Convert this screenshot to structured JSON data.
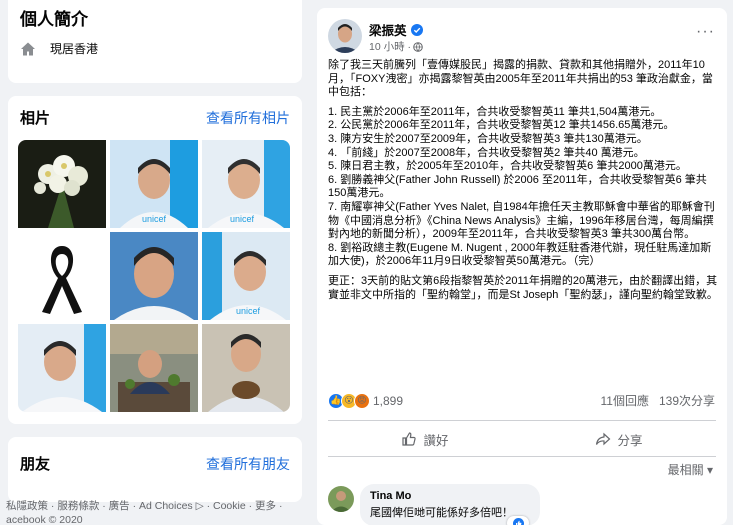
{
  "intro": {
    "title": "個人簡介",
    "location_icon": "home-icon",
    "location": "現居香港"
  },
  "photos_section": {
    "title": "相片",
    "see_all": "查看所有相片",
    "photos": [
      {
        "desc": "white flowers bouquet",
        "icon": "photo"
      },
      {
        "desc": "man in unicef shirt",
        "icon": "photo"
      },
      {
        "desc": "man in unicef shirt smiling",
        "icon": "photo"
      },
      {
        "desc": "black mourning ribbon",
        "icon": "photo"
      },
      {
        "desc": "man close-up portrait",
        "icon": "photo"
      },
      {
        "desc": "man in unicef shirt",
        "icon": "photo"
      },
      {
        "desc": "man in unicef shirt",
        "icon": "photo"
      },
      {
        "desc": "man kneeling at planter",
        "icon": "photo"
      },
      {
        "desc": "man holding food item",
        "icon": "photo"
      }
    ]
  },
  "friends_section": {
    "title": "朋友",
    "see_all": "查看所有朋友"
  },
  "footer": {
    "line1": "私隱政策 · 服務條款 · 廣告 · Ad Choices ▷ · Cookie · 更多 ·",
    "line2": "acebook © 2020"
  },
  "post": {
    "author": "梁振英",
    "time": "10 小時 ·",
    "more": "···",
    "paragraphs": [
      "除了我三天前騰列「壹傳媒股民」揭露的捐款、貸款和其他捐贈外，2011年10月，「FOXY洩密」亦揭露黎智英由2005年至2011年共捐出的53 筆政治獻金，當中包括：",
      "1. 民主黨於2006年至2011年，合共收受黎智英11 筆共1,504萬港元。\n2. 公民黨於2006年至2011年，合共收受黎智英12 筆共1456.65萬港元。\n3. 陳方安生於2007至2009年，合共收受黎智英3 筆共130萬港元。\n4. 「前綫」於2007至2008年，合共收受黎智英2 筆共40 萬港元。\n5. 陳日君主教，於2005年至2010年，合共收受黎智英6 筆共2000萬港元。\n6. 劉勝義神父(Father John Russell) 於2006 至2011年，合共收受黎智英6 筆共150萬港元。\n7. 南耀寧神父(Father Yves Nalet, 自1984年擔任天主教耶穌會中華省的耶穌會刊物《中國消息分析》《China News Analysis》主編，1996年移居台灣，每周編撰對內地的新聞分析），2009年至2011年，合共收受黎智英3 筆共300萬台幣。\n8. 劉裕政總主教(Eugene M. Nugent , 2000年教廷駐香港代辦，現任駐馬達加斯加大使)，於2006年11月9日收受黎智英50萬港元。（完）",
      "更正：3天前的貼文第6段指黎智英於2011年捐贈的20萬港元，由於翻譯出錯，其實並非文中所指的「聖約翰堂」，而是St Joseph「聖約瑟」，謹向聖約翰堂致歉。"
    ],
    "reaction_count": "1,899",
    "comments_count": "11個回應",
    "shares_count": "139次分享",
    "like_label": "讚好",
    "share_label": "分享",
    "sort_label": "最相關 ▾",
    "comment": {
      "name": "Tina Mo",
      "text": "尾國俾佢哋可能係好多倍吧！"
    }
  },
  "colors": {
    "link": "#216fdb",
    "verified": "#1877f2",
    "background": "#f0f2f5"
  }
}
